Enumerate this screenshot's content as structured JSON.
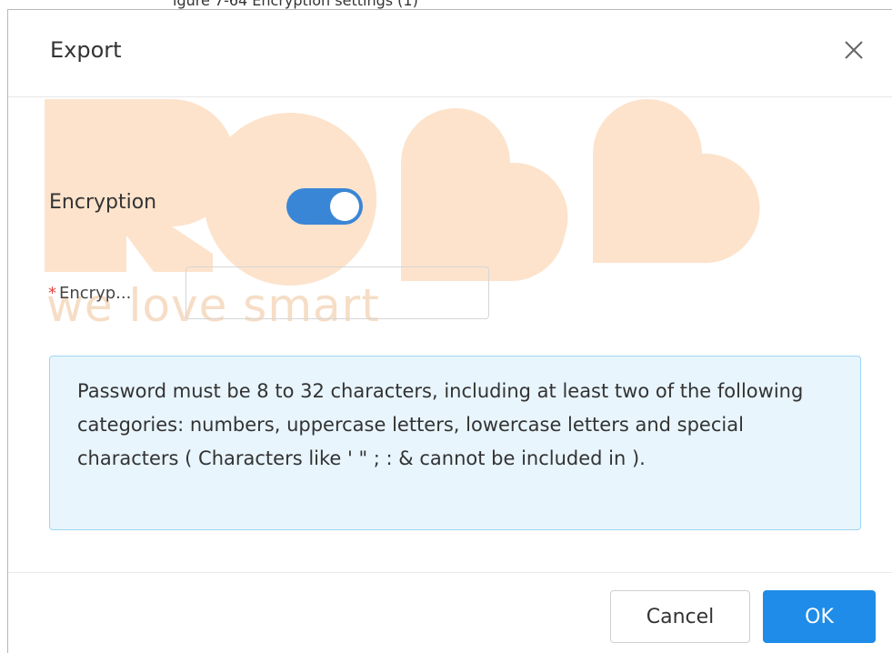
{
  "caption": "igure 7-64 Encryption settings (1)",
  "dialog": {
    "title": "Export",
    "close_icon": "close-icon"
  },
  "watermark": {
    "logo_text": "ROBB",
    "tagline": "we love smart",
    "color": "#f6ddc6"
  },
  "form": {
    "encryption_label": "Encryption",
    "encryption_enabled": true,
    "password_required_mark": "*",
    "password_label": "Encryp...",
    "password_value": "",
    "password_placeholder": ""
  },
  "hint": {
    "text": "Password must be 8 to 32 characters, including at least two of the following categories: numbers, uppercase letters, lowercase letters and special characters ( Characters like ' \" ; : & cannot be included in )."
  },
  "footer": {
    "cancel_label": "Cancel",
    "ok_label": "OK"
  },
  "colors": {
    "accent": "#1e8ce8",
    "toggle_on": "#3a86d6",
    "hint_bg": "#e8f5fd",
    "hint_border": "#9fd5f5",
    "required": "#e54545"
  }
}
